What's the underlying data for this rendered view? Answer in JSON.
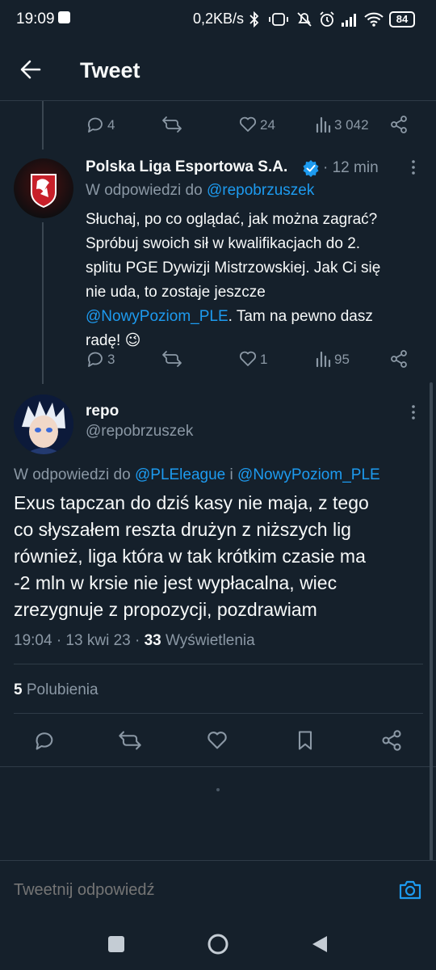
{
  "status_bar": {
    "time": "19:09",
    "network_rate": "0,2KB/s",
    "battery": "84"
  },
  "header": {
    "title": "Tweet"
  },
  "prev_tweet_actions": {
    "replies": "4",
    "retweets": "",
    "likes": "24",
    "views": "3 042"
  },
  "ple_tweet": {
    "name": "Polska Liga Esportowa S.A.",
    "time": "· 12 min",
    "reply_prefix": "W odpowiedzi do",
    "reply_to": "@repobrzuszek",
    "text_lines": [
      "Słuchaj, po co oglądać, jak można zagrać?",
      "Spróbuj swoich sił w kwalifikacjach do 2.",
      "splitu PGE Dywizji Mistrzowskiej. Jak Ci się",
      "nie uda, to zostaje jeszcze"
    ],
    "mention": "@NowyPoziom_PLE",
    "text_after_mention": ". Tam na pewno dasz",
    "text_last": "radę! 😉",
    "replies": "3",
    "likes": "1",
    "views": "95"
  },
  "main_tweet": {
    "name": "repo",
    "handle": "@repobrzuszek",
    "reply_prefix": "W odpowiedzi do",
    "reply_to_1": "@PLEleague",
    "reply_joiner": "i",
    "reply_to_2": "@NowyPoziom_PLE",
    "text_lines": [
      "Exus tapczan do dziś kasy nie maja, z tego",
      "co słyszałem reszta drużyn z niższych lig",
      "również, liga która w tak krótkim czasie ma",
      "-2 mln w krsie nie jest wypłacalna, wiec",
      "zrezygnuje z propozycji, pozdrawiam"
    ],
    "timestamp": "19:04 · 13 kwi 23 ·",
    "views_count": "33",
    "views_label": "Wyświetlenia",
    "likes_count": "5",
    "likes_label": "Polubienia"
  },
  "reply_box": {
    "placeholder": "Tweetnij odpowiedź"
  },
  "colors": {
    "background": "#15202b",
    "accent": "#1d9bf0",
    "muted": "#8b98a5",
    "divider": "#2f3b47"
  },
  "icons": [
    "back-arrow-icon",
    "reply-icon",
    "retweet-icon",
    "like-icon",
    "views-icon",
    "share-icon",
    "verified-badge-icon",
    "more-icon",
    "bookmark-icon",
    "camera-icon"
  ]
}
